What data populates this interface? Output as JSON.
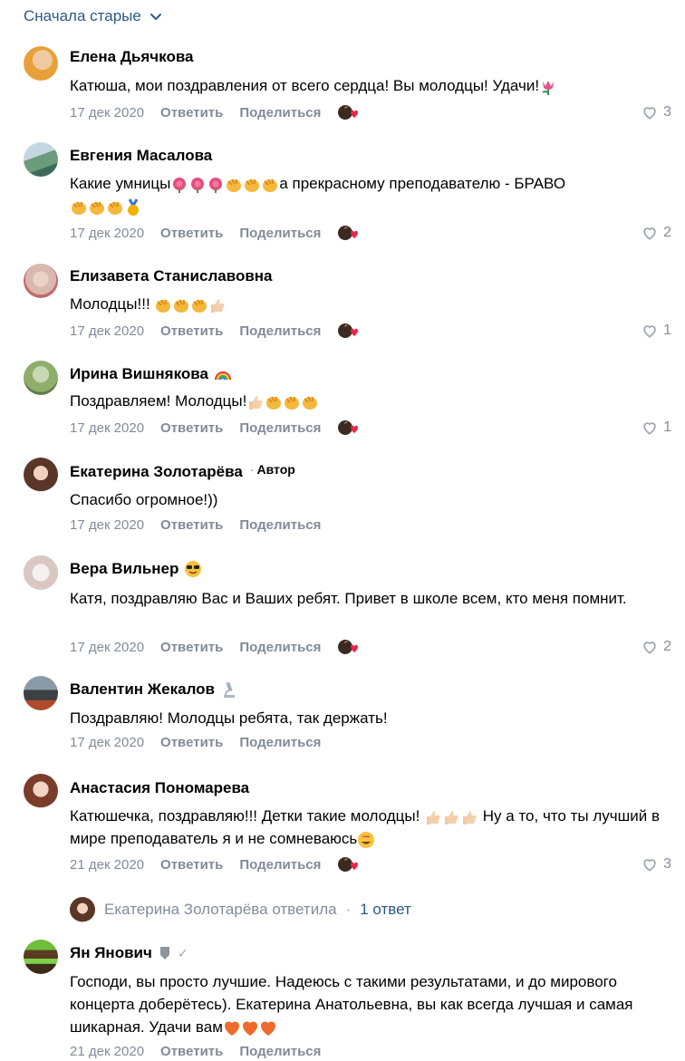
{
  "sort": {
    "label": "Сначала старые"
  },
  "actions": {
    "reply": "Ответить",
    "share": "Поделиться"
  },
  "comments": [
    {
      "name": "Елена Дьячкова",
      "text": "Катюша, мои поздравления от всего сердца! Вы молодцы! Удачи!",
      "date": "17 дек 2020",
      "likes": "3"
    },
    {
      "name": "Евгения Масалова",
      "text": "Какие умницы",
      "text2": "а прекрасному преподавателю - БРАВО",
      "date": "17 дек 2020",
      "likes": "2"
    },
    {
      "name": "Елизавета Станиславовна",
      "text": "Молодцы!!!",
      "date": "17 дек 2020",
      "likes": "1"
    },
    {
      "name": "Ирина Вишнякова",
      "text": "Поздравляем! Молодцы!",
      "date": "17 дек 2020",
      "likes": "1"
    },
    {
      "name": "Екатерина Золотарёва",
      "badge": "Автор",
      "text": "Спасибо огромное!))",
      "date": "17 дек 2020",
      "likes": ""
    },
    {
      "name": "Вера Вильнер",
      "text": "Катя, поздравляю Вас и Ваших ребят. Привет в школе всем, кто меня помнит.",
      "date": "17 дек 2020",
      "likes": "2"
    },
    {
      "name": "Валентин Жекалов",
      "text": "Поздравляю! Молодцы ребята, так держать!",
      "date": "17 дек 2020",
      "likes": ""
    },
    {
      "name": "Анастасия Пономарева",
      "text": "Катюшечка, поздравляю!!! Детки такие молодцы!",
      "text2": "Ну а то, что ты лучший в мире преподаватель я и не сомневаюсь",
      "date": "21 дек 2020",
      "likes": "3"
    },
    {
      "name": "Ян Янович",
      "text": "Господи, вы просто лучшие. Надеюсь с такими результатами, и до мирового концерта доберётесь). Екатерина Анатольевна, вы как всегда лучшая и самая шикарная. Удачи вам",
      "date": "21 дек 2020",
      "likes": ""
    }
  ],
  "thread": {
    "replier": "Екатерина Золотарёва ответила",
    "sep": "·",
    "count": "1 ответ"
  }
}
